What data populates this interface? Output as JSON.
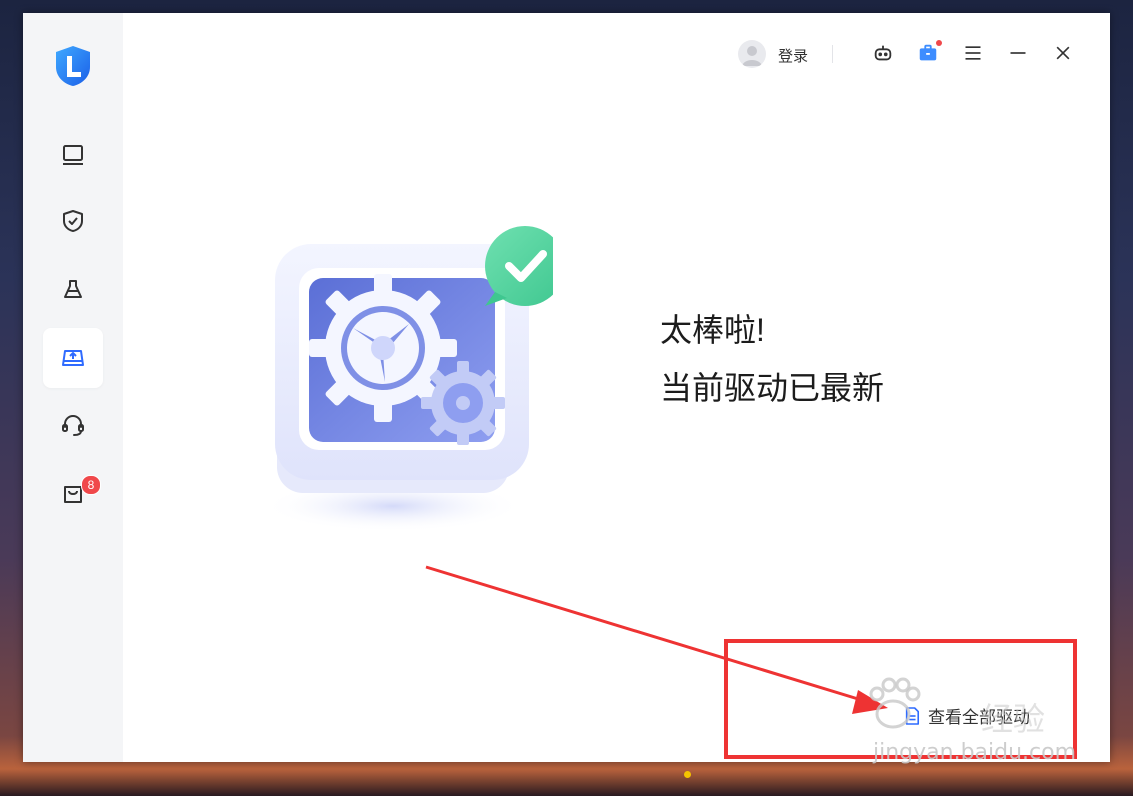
{
  "header": {
    "login_label": "登录"
  },
  "sidebar": {
    "items": [
      {
        "name": "monitor-icon",
        "active": false
      },
      {
        "name": "shield-check-icon",
        "active": false
      },
      {
        "name": "cleaner-icon",
        "active": false
      },
      {
        "name": "driver-update-icon",
        "active": true
      },
      {
        "name": "headset-icon",
        "active": false
      },
      {
        "name": "shopping-bag-icon",
        "active": false,
        "badge": "8"
      }
    ]
  },
  "main": {
    "message_line1": "太棒啦!",
    "message_line2": "当前驱动已最新",
    "view_all_label": "查看全部驱动"
  },
  "watermark": {
    "site": "jingyan.baidu.com",
    "brand": "经验"
  },
  "colors": {
    "accent": "#2f6bff",
    "badge": "#f0484b",
    "annotation": "#ee3333",
    "check_green": "#4fd49a"
  }
}
